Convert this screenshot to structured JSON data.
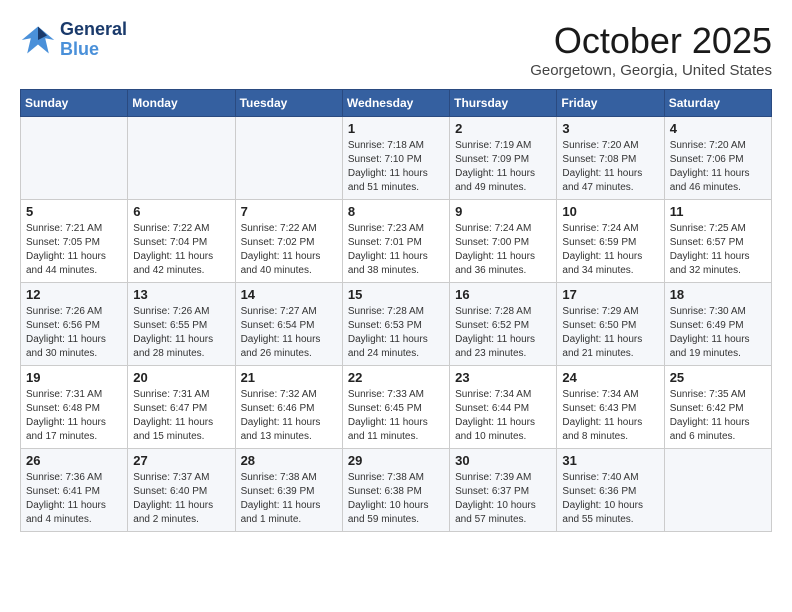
{
  "header": {
    "logo_line1": "General",
    "logo_line2": "Blue",
    "month": "October 2025",
    "location": "Georgetown, Georgia, United States"
  },
  "weekdays": [
    "Sunday",
    "Monday",
    "Tuesday",
    "Wednesday",
    "Thursday",
    "Friday",
    "Saturday"
  ],
  "weeks": [
    [
      {
        "day": "",
        "info": ""
      },
      {
        "day": "",
        "info": ""
      },
      {
        "day": "",
        "info": ""
      },
      {
        "day": "1",
        "info": "Sunrise: 7:18 AM\nSunset: 7:10 PM\nDaylight: 11 hours\nand 51 minutes."
      },
      {
        "day": "2",
        "info": "Sunrise: 7:19 AM\nSunset: 7:09 PM\nDaylight: 11 hours\nand 49 minutes."
      },
      {
        "day": "3",
        "info": "Sunrise: 7:20 AM\nSunset: 7:08 PM\nDaylight: 11 hours\nand 47 minutes."
      },
      {
        "day": "4",
        "info": "Sunrise: 7:20 AM\nSunset: 7:06 PM\nDaylight: 11 hours\nand 46 minutes."
      }
    ],
    [
      {
        "day": "5",
        "info": "Sunrise: 7:21 AM\nSunset: 7:05 PM\nDaylight: 11 hours\nand 44 minutes."
      },
      {
        "day": "6",
        "info": "Sunrise: 7:22 AM\nSunset: 7:04 PM\nDaylight: 11 hours\nand 42 minutes."
      },
      {
        "day": "7",
        "info": "Sunrise: 7:22 AM\nSunset: 7:02 PM\nDaylight: 11 hours\nand 40 minutes."
      },
      {
        "day": "8",
        "info": "Sunrise: 7:23 AM\nSunset: 7:01 PM\nDaylight: 11 hours\nand 38 minutes."
      },
      {
        "day": "9",
        "info": "Sunrise: 7:24 AM\nSunset: 7:00 PM\nDaylight: 11 hours\nand 36 minutes."
      },
      {
        "day": "10",
        "info": "Sunrise: 7:24 AM\nSunset: 6:59 PM\nDaylight: 11 hours\nand 34 minutes."
      },
      {
        "day": "11",
        "info": "Sunrise: 7:25 AM\nSunset: 6:57 PM\nDaylight: 11 hours\nand 32 minutes."
      }
    ],
    [
      {
        "day": "12",
        "info": "Sunrise: 7:26 AM\nSunset: 6:56 PM\nDaylight: 11 hours\nand 30 minutes."
      },
      {
        "day": "13",
        "info": "Sunrise: 7:26 AM\nSunset: 6:55 PM\nDaylight: 11 hours\nand 28 minutes."
      },
      {
        "day": "14",
        "info": "Sunrise: 7:27 AM\nSunset: 6:54 PM\nDaylight: 11 hours\nand 26 minutes."
      },
      {
        "day": "15",
        "info": "Sunrise: 7:28 AM\nSunset: 6:53 PM\nDaylight: 11 hours\nand 24 minutes."
      },
      {
        "day": "16",
        "info": "Sunrise: 7:28 AM\nSunset: 6:52 PM\nDaylight: 11 hours\nand 23 minutes."
      },
      {
        "day": "17",
        "info": "Sunrise: 7:29 AM\nSunset: 6:50 PM\nDaylight: 11 hours\nand 21 minutes."
      },
      {
        "day": "18",
        "info": "Sunrise: 7:30 AM\nSunset: 6:49 PM\nDaylight: 11 hours\nand 19 minutes."
      }
    ],
    [
      {
        "day": "19",
        "info": "Sunrise: 7:31 AM\nSunset: 6:48 PM\nDaylight: 11 hours\nand 17 minutes."
      },
      {
        "day": "20",
        "info": "Sunrise: 7:31 AM\nSunset: 6:47 PM\nDaylight: 11 hours\nand 15 minutes."
      },
      {
        "day": "21",
        "info": "Sunrise: 7:32 AM\nSunset: 6:46 PM\nDaylight: 11 hours\nand 13 minutes."
      },
      {
        "day": "22",
        "info": "Sunrise: 7:33 AM\nSunset: 6:45 PM\nDaylight: 11 hours\nand 11 minutes."
      },
      {
        "day": "23",
        "info": "Sunrise: 7:34 AM\nSunset: 6:44 PM\nDaylight: 11 hours\nand 10 minutes."
      },
      {
        "day": "24",
        "info": "Sunrise: 7:34 AM\nSunset: 6:43 PM\nDaylight: 11 hours\nand 8 minutes."
      },
      {
        "day": "25",
        "info": "Sunrise: 7:35 AM\nSunset: 6:42 PM\nDaylight: 11 hours\nand 6 minutes."
      }
    ],
    [
      {
        "day": "26",
        "info": "Sunrise: 7:36 AM\nSunset: 6:41 PM\nDaylight: 11 hours\nand 4 minutes."
      },
      {
        "day": "27",
        "info": "Sunrise: 7:37 AM\nSunset: 6:40 PM\nDaylight: 11 hours\nand 2 minutes."
      },
      {
        "day": "28",
        "info": "Sunrise: 7:38 AM\nSunset: 6:39 PM\nDaylight: 11 hours\nand 1 minute."
      },
      {
        "day": "29",
        "info": "Sunrise: 7:38 AM\nSunset: 6:38 PM\nDaylight: 10 hours\nand 59 minutes."
      },
      {
        "day": "30",
        "info": "Sunrise: 7:39 AM\nSunset: 6:37 PM\nDaylight: 10 hours\nand 57 minutes."
      },
      {
        "day": "31",
        "info": "Sunrise: 7:40 AM\nSunset: 6:36 PM\nDaylight: 10 hours\nand 55 minutes."
      },
      {
        "day": "",
        "info": ""
      }
    ]
  ]
}
